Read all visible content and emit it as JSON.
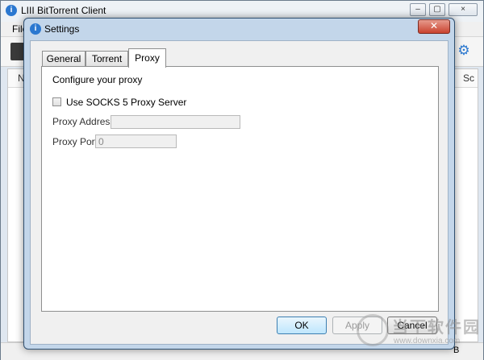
{
  "main_window": {
    "title": "LIII BitTorrent Client",
    "app_icon": "info-icon",
    "controls": {
      "minimize": "–",
      "maximize": "▢",
      "close": "×"
    },
    "menu": {
      "file_label": "File"
    },
    "list_header": {
      "left_col": "N",
      "right_col": "Sc"
    },
    "status_right": "B"
  },
  "dialog": {
    "title": "Settings",
    "icon": "info-icon",
    "close_glyph": "✕",
    "tabs": [
      {
        "label": "General",
        "active": false
      },
      {
        "label": "Torrent",
        "active": false
      },
      {
        "label": "Proxy",
        "active": true
      }
    ],
    "proxy": {
      "heading": "Configure your proxy",
      "socks5_label": "Use SOCKS 5 Proxy Server",
      "socks5_checked": false,
      "address_label": "Proxy Address:",
      "address_value": "",
      "port_label": "Proxy Port:",
      "port_value": "0"
    },
    "buttons": {
      "ok": "OK",
      "apply": "Apply",
      "cancel": "Cancel"
    }
  },
  "watermark": {
    "line1": "当下软件园",
    "line2": "www.downxia.com"
  }
}
